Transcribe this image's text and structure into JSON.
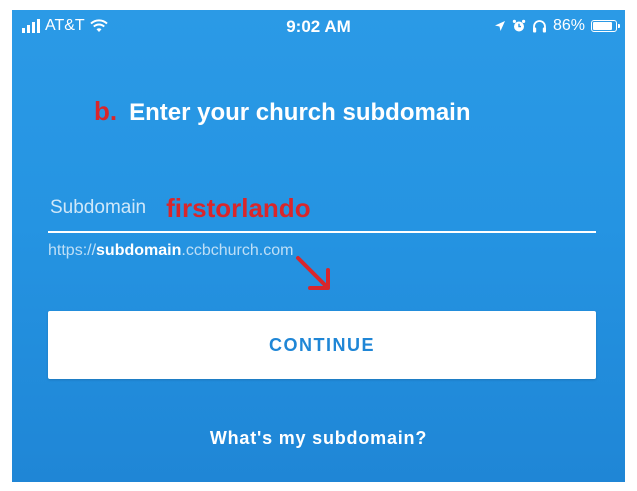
{
  "status_bar": {
    "carrier": "AT&T",
    "time": "9:02 AM",
    "battery": "86%",
    "signal_icon": "signal-bars-icon",
    "wifi_icon": "wifi-icon",
    "location_icon": "location-arrow-icon",
    "alarm_icon": "alarm-clock-icon",
    "headphones_icon": "headphones-icon"
  },
  "header": {
    "step_marker": "b.",
    "title": "Enter your church subdomain"
  },
  "form": {
    "subdomain_label": "Subdomain",
    "subdomain_value": "firstorlando",
    "hint_prefix": "https://",
    "hint_bold": "subdomain",
    "hint_suffix": ".ccbchurch.com"
  },
  "actions": {
    "continue_label": "CONTINUE",
    "help_link": "What's my subdomain?"
  },
  "colors": {
    "background": "#2594e2",
    "annotation": "#d9262b",
    "button_text": "#1f86d6"
  }
}
